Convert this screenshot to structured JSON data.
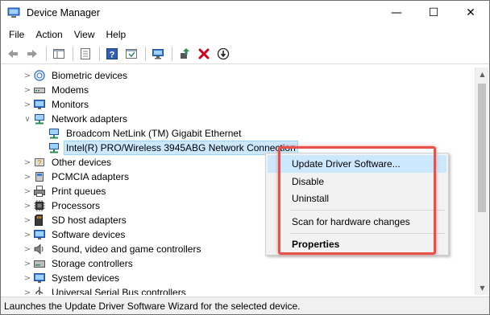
{
  "window": {
    "title": "Device Manager",
    "controls": {
      "minimize": "—",
      "maximize": "☐",
      "close": "✕"
    }
  },
  "menubar": {
    "items": [
      "File",
      "Action",
      "View",
      "Help"
    ]
  },
  "toolbar": {
    "buttons": [
      "back-icon",
      "forward-icon",
      "show-hide-console-tree-icon",
      "properties-icon",
      "help-icon",
      "show-action-pane-icon",
      "scan-hardware-icon",
      "update-driver-icon",
      "uninstall-icon",
      "disable-icon"
    ],
    "colors": {
      "uninstall": "#d0021b",
      "update": "#2e8b57"
    }
  },
  "tree": {
    "items": [
      {
        "label": "Biometric devices",
        "expanded": false,
        "icon": "biometric-icon"
      },
      {
        "label": "Modems",
        "expanded": false,
        "icon": "modem-icon"
      },
      {
        "label": "Monitors",
        "expanded": false,
        "icon": "monitor-icon"
      },
      {
        "label": "Network adapters",
        "expanded": true,
        "icon": "network-adapter-icon"
      },
      {
        "label": "Broadcom NetLink (TM) Gigabit Ethernet",
        "child": true,
        "icon": "network-adapter-icon"
      },
      {
        "label": "Intel(R) PRO/Wireless 3945ABG Network Connection",
        "child": true,
        "selected": true,
        "icon": "network-adapter-icon"
      },
      {
        "label": "Other devices",
        "expanded": false,
        "icon": "other-devices-icon"
      },
      {
        "label": "PCMCIA adapters",
        "expanded": false,
        "icon": "pcmcia-icon"
      },
      {
        "label": "Print queues",
        "expanded": false,
        "icon": "printer-icon"
      },
      {
        "label": "Processors",
        "expanded": false,
        "icon": "processor-icon"
      },
      {
        "label": "SD host adapters",
        "expanded": false,
        "icon": "sd-card-icon"
      },
      {
        "label": "Software devices",
        "expanded": false,
        "icon": "software-device-icon"
      },
      {
        "label": "Sound, video and game controllers",
        "expanded": false,
        "icon": "sound-icon"
      },
      {
        "label": "Storage controllers",
        "expanded": false,
        "icon": "storage-icon"
      },
      {
        "label": "System devices",
        "expanded": false,
        "icon": "system-devices-icon"
      },
      {
        "label": "Universal Serial Bus controllers",
        "expanded": false,
        "icon": "usb-icon"
      }
    ]
  },
  "context_menu": {
    "items": [
      {
        "label": "Update Driver Software...",
        "highlighted": true
      },
      {
        "label": "Disable"
      },
      {
        "label": "Uninstall"
      },
      {
        "label": "Scan for hardware changes"
      },
      {
        "label": "Properties",
        "bold": true
      }
    ],
    "annotation_color": "#e8504a"
  },
  "statusbar": {
    "text": "Launches the Update Driver Software Wizard for the selected device."
  }
}
